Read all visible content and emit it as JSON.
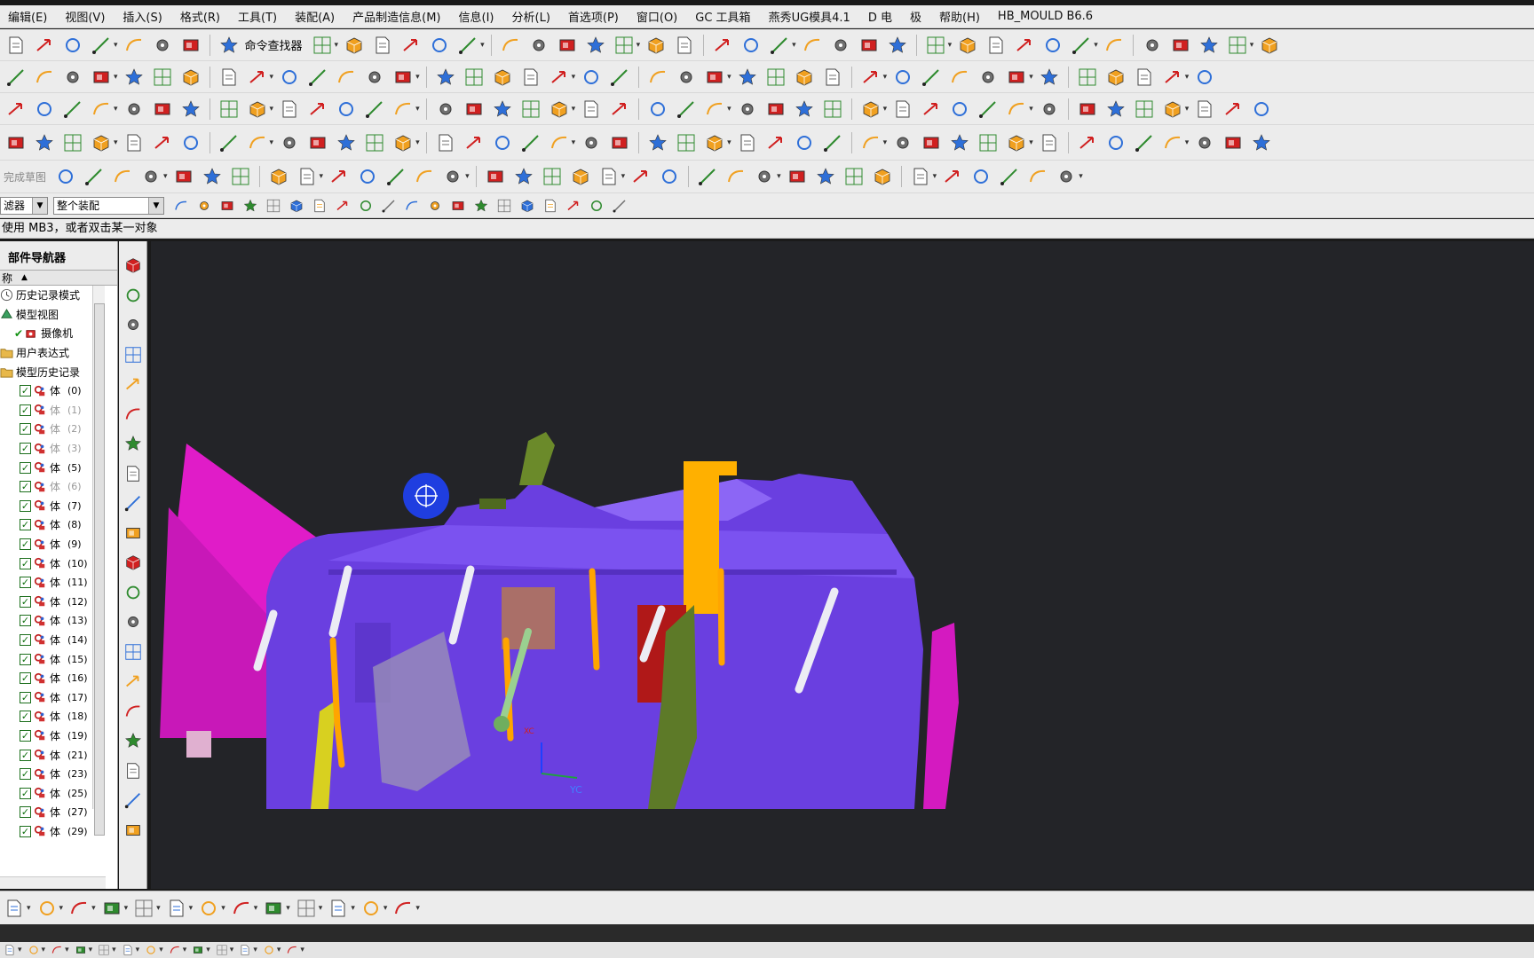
{
  "menu": [
    "编辑(E)",
    "视图(V)",
    "插入(S)",
    "格式(R)",
    "工具(T)",
    "装配(A)",
    "产品制造信息(M)",
    "信息(I)",
    "分析(L)",
    "首选项(P)",
    "窗口(O)",
    "GC 工具箱",
    "燕秀UG模具4.1",
    "D 电",
    "极",
    "帮助(H)",
    "HB_MOULD B6.6"
  ],
  "toolbar": {
    "command_finder_label": "命令查找器",
    "sketch_finish_label": "完成草图"
  },
  "filter": {
    "type_filter_value": "滤器",
    "scope_filter_value": "整个装配"
  },
  "status_message": "使用 MB3，或者双击某一对象",
  "part_navigator": {
    "title": "部件导航器",
    "column_header": "称",
    "top_nodes": [
      "历史记录模式",
      "模型视图",
      "摄像机",
      "用户表达式",
      "模型历史记录"
    ],
    "body_label": "体",
    "bodies": [
      {
        "idx": "(0)",
        "dim": false
      },
      {
        "idx": "(1)",
        "dim": true
      },
      {
        "idx": "(2)",
        "dim": true
      },
      {
        "idx": "(3)",
        "dim": true
      },
      {
        "idx": "(5)",
        "dim": false
      },
      {
        "idx": "(6)",
        "dim": true
      },
      {
        "idx": "(7)",
        "dim": false
      },
      {
        "idx": "(8)",
        "dim": false
      },
      {
        "idx": "(9)",
        "dim": false
      },
      {
        "idx": "(10)",
        "dim": false
      },
      {
        "idx": "(11)",
        "dim": false
      },
      {
        "idx": "(12)",
        "dim": false
      },
      {
        "idx": "(13)",
        "dim": false
      },
      {
        "idx": "(14)",
        "dim": false
      },
      {
        "idx": "(15)",
        "dim": false
      },
      {
        "idx": "(16)",
        "dim": false
      },
      {
        "idx": "(17)",
        "dim": false
      },
      {
        "idx": "(18)",
        "dim": false
      },
      {
        "idx": "(19)",
        "dim": false
      },
      {
        "idx": "(21)",
        "dim": false
      },
      {
        "idx": "(23)",
        "dim": false
      },
      {
        "idx": "(25)",
        "dim": false
      },
      {
        "idx": "(27)",
        "dim": false
      },
      {
        "idx": "(29)",
        "dim": false
      }
    ]
  },
  "viewport": {
    "triad_label": "YC",
    "axis_small_label": "XC",
    "colors": {
      "background": "#232428",
      "mold_base": "#6a3fe0",
      "slider_magenta": "#e01cc8",
      "ejector_pin": "#e8e8f0",
      "orange_pin": "#ffa500",
      "green_part": "#6b8a2a",
      "red_insert": "#b01818"
    }
  },
  "icon_colors": {
    "blue": "#2e6fd8",
    "orange": "#f0a020",
    "red": "#d02020",
    "green": "#2e8a2e",
    "gray": "#707070"
  }
}
